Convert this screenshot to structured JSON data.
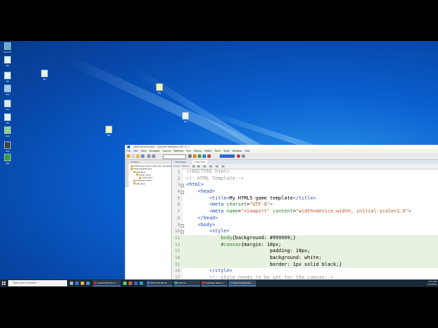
{
  "ide": {
    "title": "Module1JsHandler - Apache NetBeans IDE 11.1",
    "menu": [
      "File",
      "Edit",
      "View",
      "Navigate",
      "Source",
      "Refactor",
      "Run",
      "Debug",
      "Profile",
      "Team",
      "Tools",
      "Window",
      "Help"
    ],
    "panel_tabs": "Projects",
    "tree": [
      "HTML5Application_Module1_Template",
      "Module1JsHandler",
      "Site Root",
      "public_html",
      "index.html",
      "Important Files",
      "Site Root"
    ],
    "editor_tabs": [
      "Start Page",
      "index.html"
    ],
    "source_label": "Source",
    "history_label": "History",
    "code": [
      {
        "n": "1",
        "html": "<span class=\"c-cm\">&lt;!DOCTYPE html&gt;</span>",
        "hl": false,
        "fold": false
      },
      {
        "n": "2",
        "html": "<span class=\"c-cm\">&lt;!--HTML Template--&gt;</span>",
        "hl": false,
        "fold": false
      },
      {
        "n": "3",
        "html": "<span class=\"c-tag\">&lt;html&gt;</span>",
        "hl": false,
        "fold": true
      },
      {
        "n": "4",
        "html": "    <span class=\"c-tag\">&lt;head&gt;</span>",
        "hl": false,
        "fold": true
      },
      {
        "n": "5",
        "html": "        <span class=\"c-tag\">&lt;title&gt;</span>My HTML5 game template<span class=\"c-tag\">&lt;/title&gt;</span>",
        "hl": false,
        "fold": false
      },
      {
        "n": "6",
        "html": "        <span class=\"c-tag\">&lt;meta</span> <span class=\"c-attr\">charset</span>=<span class=\"c-val\">\"UTF-8\"</span><span class=\"c-tag\">&gt;</span>",
        "hl": false,
        "fold": false
      },
      {
        "n": "7",
        "html": "        <span class=\"c-tag\">&lt;meta</span> <span class=\"c-attr\">name</span>=<span class=\"c-val\">\"viewport\"</span> <span class=\"c-attr\">content</span>=<span class=\"c-val\">\"width=device-width, initial-scale=1.0\"</span><span class=\"c-tag\">&gt;</span>",
        "hl": false,
        "fold": false
      },
      {
        "n": "8",
        "html": "    <span class=\"c-tag\">&lt;/head&gt;</span>",
        "hl": false,
        "fold": false
      },
      {
        "n": "9",
        "html": "    <span class=\"c-tag\">&lt;body&gt;</span>",
        "hl": false,
        "fold": true
      },
      {
        "n": "10",
        "html": "        <span class=\"c-tag\">&lt;style&gt;</span>",
        "hl": false,
        "fold": true
      },
      {
        "n": "11",
        "html": "            <span class=\"c-css\">body</span>{background: #999999;}",
        "hl": true,
        "fold": false
      },
      {
        "n": "12",
        "html": "            <span class=\"c-css\">#canvas</span>{margin: 10px;",
        "hl": true,
        "fold": false
      },
      {
        "n": "13",
        "html": "                             padding: 10px;",
        "hl": true,
        "fold": false
      },
      {
        "n": "14",
        "html": "                             background: white;",
        "hl": true,
        "fold": false
      },
      {
        "n": "15",
        "html": "                             border: 1px solid black;}",
        "hl": true,
        "fold": false
      },
      {
        "n": "16",
        "html": "        <span class=\"c-tag\">&lt;/style&gt;</span>",
        "hl": false,
        "fold": false
      },
      {
        "n": "17",
        "html": "        <span class=\"c-cm\">&lt;!--style needs to be set for the canvas--&gt;</span>",
        "hl": false,
        "fold": false
      }
    ]
  },
  "taskbar": {
    "search_placeholder": "Type here to search",
    "apps": [
      "Create Module Co...",
      "Microsoft Windo...",
      "Pictures",
      "matchjavi Base li...",
      "Module1JsHandle..."
    ],
    "time": "3:57 AM",
    "date": "2/4/2020"
  },
  "colors": {
    "desktop": "#0a5fcf",
    "taskbar": "#1b2a38",
    "highlight": "#e8f2e0",
    "netbeans": "#1b6ac9"
  }
}
